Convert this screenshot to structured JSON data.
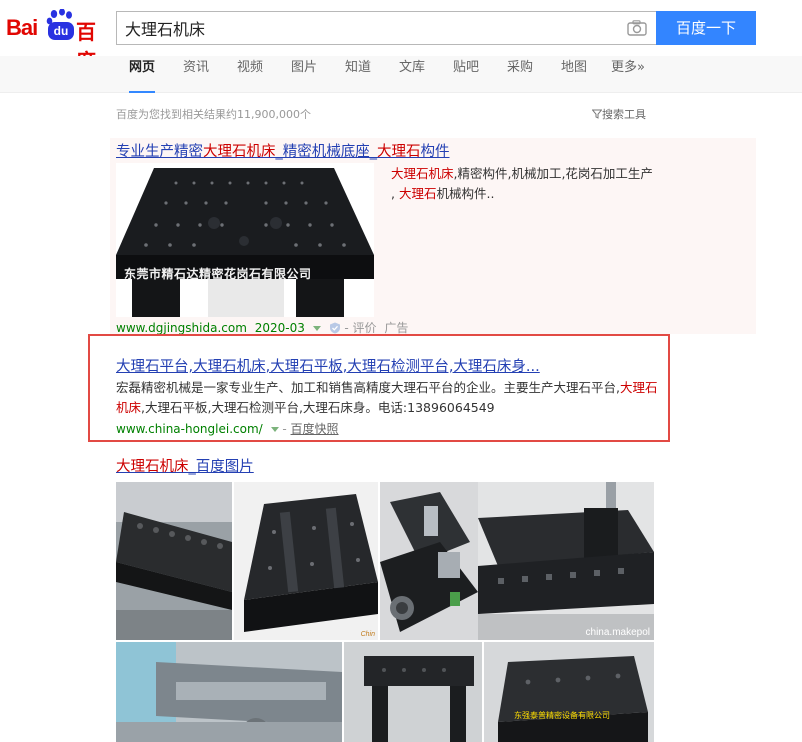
{
  "logo": {
    "bai": "Bai",
    "du": "du",
    "cn": "百度"
  },
  "search": {
    "query": "大理石机床",
    "button": "百度一下"
  },
  "nav": {
    "tabs": [
      {
        "label": "网页",
        "active": true
      },
      {
        "label": "资讯"
      },
      {
        "label": "视频"
      },
      {
        "label": "图片"
      },
      {
        "label": "知道"
      },
      {
        "label": "文库"
      },
      {
        "label": "贴吧"
      },
      {
        "label": "采购"
      },
      {
        "label": "地图"
      },
      {
        "label": "更多»"
      }
    ]
  },
  "result_count": "百度为您找到相关结果约11,900,000个",
  "tools": "搜索工具",
  "ad": {
    "title_parts": [
      "专业生产精密",
      "大理石机床",
      "_精密机械底座_",
      "大理石",
      "构件"
    ],
    "image_caption": "东莞市精石达精密花岗石有限公司",
    "desc_parts": [
      "大理石机床",
      ",精密构件,机械加工,花岗石加工生产 , ",
      "大理石",
      "机械构件.."
    ],
    "url": "www.dgjingshida.com",
    "date": "2020-03",
    "rating": "- 评价",
    "tag": "广告"
  },
  "result2": {
    "title": "大理石平台,大理石机床,大理石平板,大理石检测平台,大理石床身...",
    "desc_parts": [
      "宏磊精密机械是一家专业生产、加工和销售高精度大理石平台的企业。主要生产大理石平台,",
      "大理石机床",
      ",大理石平板,大理石检测平台,大理石床身。电话:13896064549"
    ],
    "url": "www.china-honglei.com/",
    "snapshot": "百度快照"
  },
  "images": {
    "title_parts": [
      "大理石机床",
      "_百度图片"
    ],
    "watermark": "china.makepol",
    "tile_logo": "Chin",
    "tile_text": "东强泰普精密设备有限公司"
  },
  "colors": {
    "brand_red": "#e10602",
    "brand_blue": "#2932e1",
    "link": "#2440b3",
    "highlight": "#cc0000",
    "url_green": "#008000",
    "button_blue": "#3385ff",
    "annotation_red": "#e24a44"
  }
}
